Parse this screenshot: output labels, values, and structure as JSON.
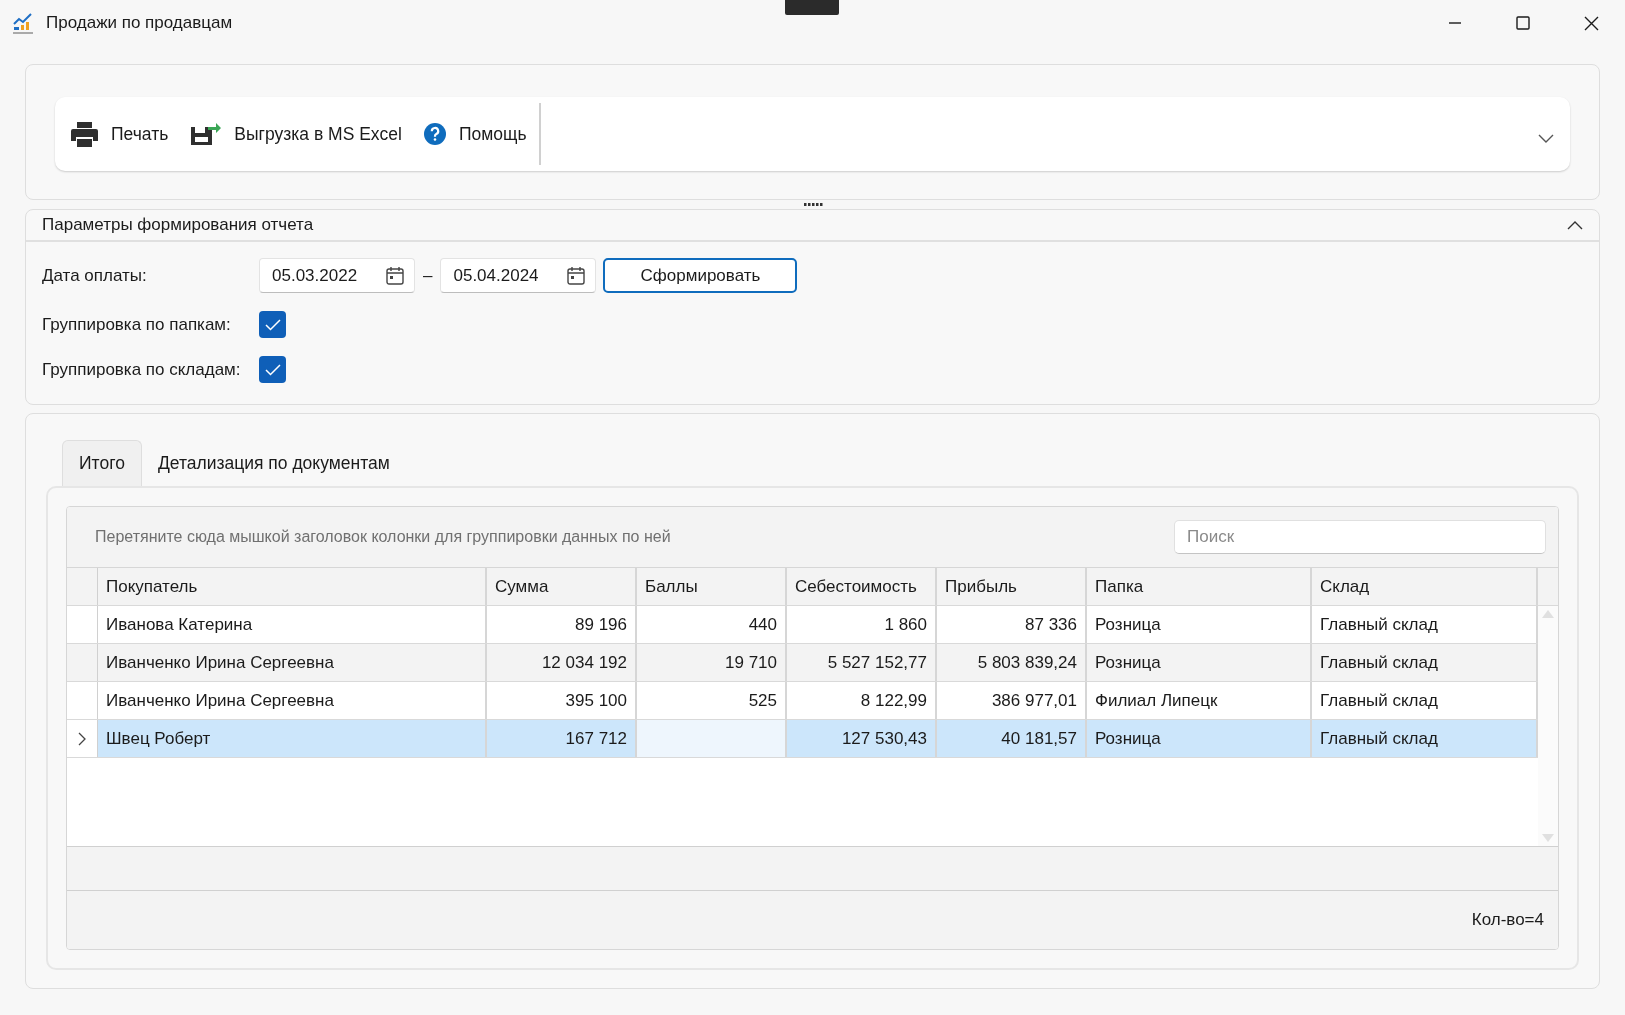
{
  "window": {
    "title": "Продажи по продавцам"
  },
  "toolbar": {
    "items": [
      {
        "kind": "print",
        "label": "Печать"
      },
      {
        "kind": "export",
        "label": "Выгрузка в MS Excel"
      },
      {
        "kind": "help",
        "label": "Помощь"
      }
    ]
  },
  "parameters": {
    "title": "Параметры формирования отчета",
    "expanded": true,
    "date_label": "Дата оплаты:",
    "date_from": "05.03.2022",
    "date_separator": "–",
    "date_to": "05.04.2024",
    "build_button": "Сформировать",
    "checks": [
      {
        "label": "Группировка по папкам:",
        "checked": true
      },
      {
        "label": "Группировка по складам:",
        "checked": true
      }
    ]
  },
  "tabs": [
    {
      "label": "Итого",
      "selected": true
    },
    {
      "label": "Детализация по документам",
      "selected": false
    }
  ],
  "grid": {
    "group_hint": "Перетяните сюда мышкой заголовок колонки для группировки данных по ней",
    "search": {
      "placeholder": "Поиск"
    },
    "columns": [
      {
        "label": "Покупатель"
      },
      {
        "label": "Сумма"
      },
      {
        "label": "Баллы"
      },
      {
        "label": "Себестоимость"
      },
      {
        "label": "Прибыль"
      },
      {
        "label": "Папка"
      },
      {
        "label": "Склад"
      }
    ],
    "rows": [
      {
        "selected": false,
        "cells": [
          "Иванова Катерина",
          "89 196",
          "440",
          "1 860",
          "87 336",
          "Розница",
          "Главный склад"
        ]
      },
      {
        "selected": false,
        "cells": [
          "Иванченко Ирина Сергеевна",
          "12 034 192",
          "19 710",
          "5 527 152,77",
          "5 803 839,24",
          "Розница",
          "Главный склад"
        ]
      },
      {
        "selected": false,
        "cells": [
          "Иванченко Ирина Сергеевна",
          "395 100",
          "525",
          "8 122,99",
          "386 977,01",
          "Филиал Липецк",
          "Главный склад"
        ]
      },
      {
        "selected": true,
        "cells": [
          "Швец Роберт",
          "167 712",
          {
            "focused": true
          },
          "127 530,43",
          "40 181,57",
          "Розница",
          "Главный склад"
        ]
      }
    ],
    "summary": "Кол-во=4"
  }
}
